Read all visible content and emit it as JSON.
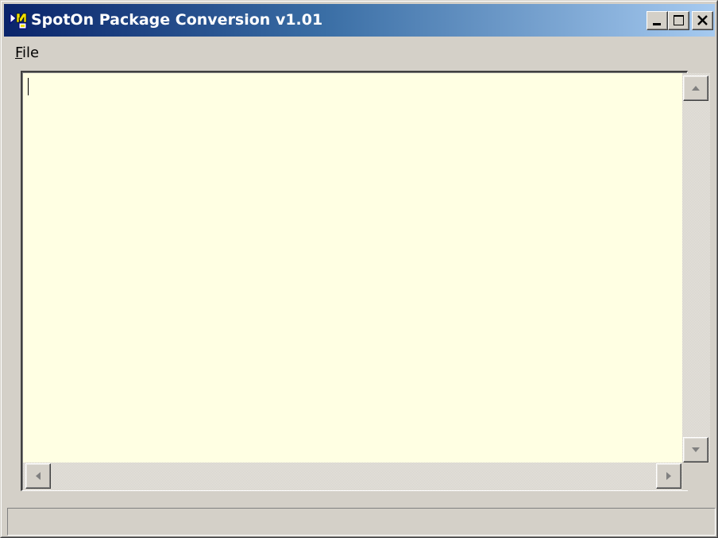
{
  "window": {
    "title": "SpotOn Package Conversion v1.01",
    "icon": "app-icon"
  },
  "title_buttons": {
    "minimize_icon": "minimize-icon",
    "maximize_icon": "maximize-icon",
    "close_icon": "close-icon"
  },
  "menu": {
    "file": {
      "accel": "F",
      "rest": "ile"
    }
  },
  "editor": {
    "content": "",
    "background": "#ffffe3"
  },
  "scrollbars": {
    "up_icon": "arrow-up-icon",
    "down_icon": "arrow-down-icon",
    "left_icon": "arrow-left-icon",
    "right_icon": "arrow-right-icon"
  },
  "statusbar": {
    "text": ""
  },
  "colors": {
    "titlebar_start": "#0a246a",
    "titlebar_end": "#a6caf0",
    "face": "#d4d0c8"
  }
}
